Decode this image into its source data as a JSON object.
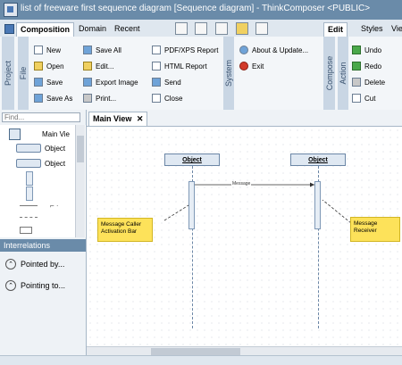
{
  "window": {
    "title": "list of freeware first sequence diagram [Sequence diagram] - ThinkComposer <PUBLIC>"
  },
  "ribbon_tabs": {
    "composition": "Composition",
    "domain": "Domain",
    "recent": "Recent",
    "edit": "Edit",
    "styles": "Styles",
    "view": "Vie"
  },
  "groups": {
    "project": "Project",
    "file": "File",
    "system": "System",
    "compose": "Compose",
    "action": "Action"
  },
  "file_buttons": {
    "new": "New",
    "open": "Open",
    "save": "Save",
    "save_as": "Save As",
    "save_all": "Save All",
    "edit": "Edit...",
    "export_image": "Export Image",
    "print": "Print...",
    "pdf_xps": "PDF/XPS Report",
    "html_report": "HTML Report",
    "send": "Send",
    "close": "Close"
  },
  "system_buttons": {
    "about": "About & Update...",
    "exit": "Exit"
  },
  "action_buttons": {
    "undo": "Undo",
    "redo": "Redo",
    "delete": "Delete",
    "cut": "Cut"
  },
  "left_panel": {
    "find_placeholder": "Find...",
    "palette": {
      "main_view": "Main Vie",
      "object1": "Object",
      "object2": "Object"
    },
    "interrelations_title": "Interrelations",
    "pointed_by": "Pointed by...",
    "pointing_to": "Pointing to..."
  },
  "doc_tab": {
    "label": "Main View",
    "close": "✕"
  },
  "diagram": {
    "object_left": "Object",
    "object_right": "Object",
    "message": "Message",
    "note_left": "Message Caller Activation Bar",
    "note_right": "Message Receiver"
  },
  "colors": {
    "titlebar": "#6a8ba9",
    "note": "#fde25a",
    "object_fill": "#dfe8f2"
  }
}
